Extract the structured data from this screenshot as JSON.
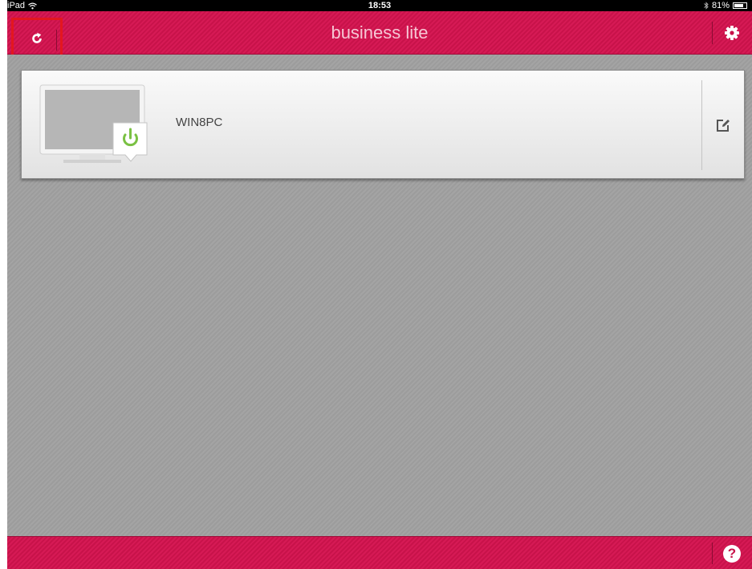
{
  "status_bar": {
    "device": "iPad",
    "time": "18:53",
    "battery": "81%",
    "battery_level": 0.81,
    "icons": [
      "wifi-icon",
      "bluetooth-icon",
      "battery-icon"
    ]
  },
  "header": {
    "title": "business lite",
    "left_icon": "refresh-icon",
    "right_icon": "gear-icon"
  },
  "devices": [
    {
      "name": "WIN8PC",
      "power_icon": "power-icon",
      "edit_icon": "edit-icon",
      "status_color": "#7ac143"
    }
  ],
  "footer": {
    "help_label": "?"
  },
  "colors": {
    "accent": "#d61a55",
    "highlight_box": "#e3171f",
    "background": "#a0a0a0"
  }
}
